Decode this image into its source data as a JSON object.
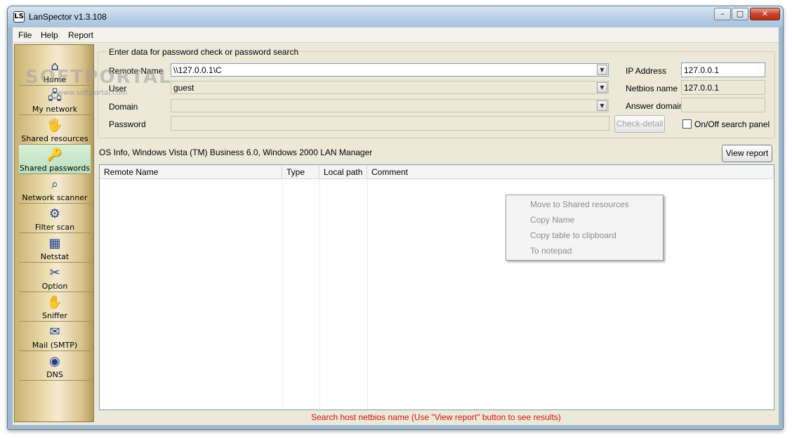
{
  "window": {
    "title": "LanSpector v1.3.108",
    "min": "–",
    "max": "□",
    "close": "✕",
    "icon": "LS"
  },
  "menu": [
    "File",
    "Help",
    "Report"
  ],
  "sidebar": {
    "items": [
      {
        "label": "Home",
        "icon": "⌂",
        "icon_name": "home-icon"
      },
      {
        "label": "My network",
        "icon": "🖧",
        "icon_name": "network-icon"
      },
      {
        "label": "Shared resources",
        "icon": "🖐",
        "icon_name": "shared-hand-icon"
      },
      {
        "label": "Shared passwords",
        "icon": "🔑",
        "icon_name": "keys-icon"
      },
      {
        "label": "Network scanner",
        "icon": "⌕",
        "icon_name": "scanner-icon"
      },
      {
        "label": "Filter scan",
        "icon": "⚙",
        "icon_name": "filter-icon"
      },
      {
        "label": "Netstat",
        "icon": "▦",
        "icon_name": "netstat-icon"
      },
      {
        "label": "Option",
        "icon": "✂",
        "icon_name": "tools-icon"
      },
      {
        "label": "Sniffer",
        "icon": "✋",
        "icon_name": "sniffer-icon"
      },
      {
        "label": "Mail (SMTP)",
        "icon": "✉",
        "icon_name": "mail-icon"
      },
      {
        "label": "DNS",
        "icon": "◉",
        "icon_name": "globe-icon"
      }
    ],
    "active_index": 3
  },
  "form": {
    "group_title": "Enter data for password check or password search",
    "remote_name_label": "Remote Name",
    "remote_name_value": "\\\\127.0.0.1\\C",
    "user_label": "User",
    "user_value": "guest",
    "domain_label": "Domain",
    "domain_value": "",
    "password_label": "Password",
    "check_detail": "Check-detail",
    "ip_label": "IP Address",
    "ip_value": "127.0.0.1",
    "netbios_label": "Netbios name",
    "netbios_value": "127.0.0.1",
    "answer_domain_label": "Answer domain",
    "answer_domain_value": "",
    "search_panel_label": "On/Off search panel"
  },
  "os_info": "OS Info, Windows Vista (TM) Business 6.0, Windows 2000 LAN Manager",
  "view_report": "View report",
  "table": {
    "columns": [
      "Remote Name",
      "Type",
      "Local path",
      "Comment"
    ]
  },
  "context_menu": [
    "Move to Shared resources",
    "Copy Name",
    "Copy table to clipboard",
    "To notepad"
  ],
  "status": "Search host netbios name (Use \"View report\" button to see results)",
  "watermark": {
    "main": "SOFTPORTAL",
    "sub": "www.softportal.com"
  }
}
